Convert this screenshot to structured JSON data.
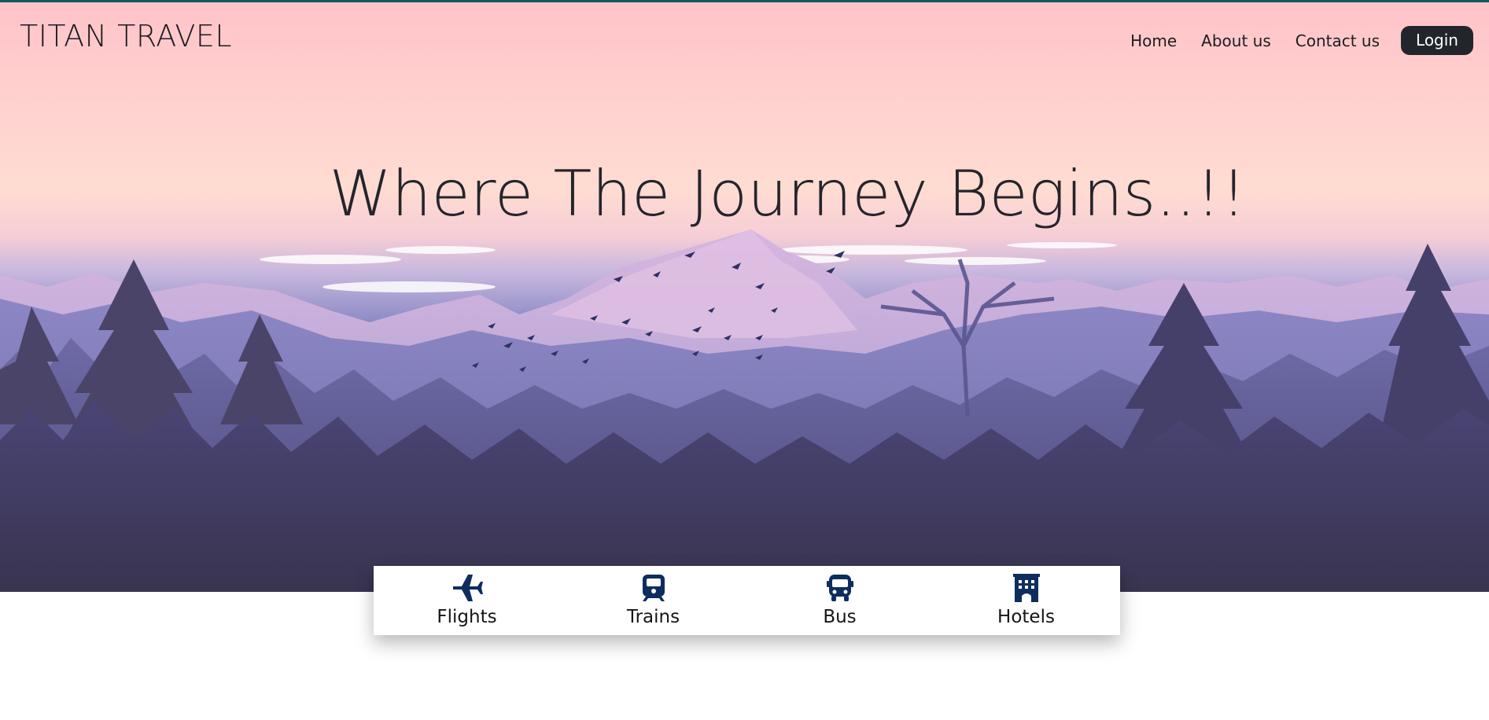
{
  "brand": {
    "name": "TITAN TRAVEL"
  },
  "nav": {
    "items": [
      {
        "label": "Home"
      },
      {
        "label": "About us"
      },
      {
        "label": "Contact us"
      }
    ],
    "login_label": "Login"
  },
  "hero": {
    "headline": "Where The Journey Begins..!!"
  },
  "tabs": {
    "items": [
      {
        "label": "Flights",
        "icon": "plane-icon"
      },
      {
        "label": "Trains",
        "icon": "train-icon"
      },
      {
        "label": "Bus",
        "icon": "bus-icon"
      },
      {
        "label": "Hotels",
        "icon": "hotel-icon"
      }
    ]
  },
  "colors": {
    "accent_line": "#0f5a5f",
    "icon": "#0d2d5e",
    "login_bg": "#22262c"
  }
}
